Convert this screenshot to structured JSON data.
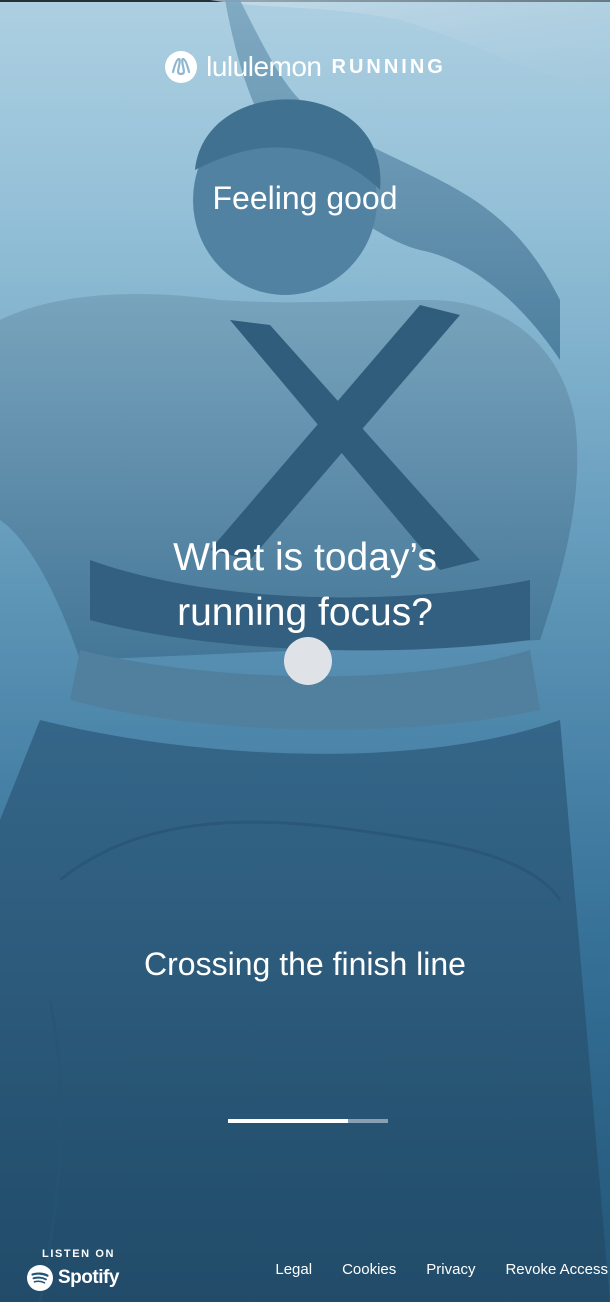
{
  "brand": {
    "name": "lululemon",
    "sub": "RUNNING",
    "logo_icon": "lululemon-logo-icon"
  },
  "options": {
    "top": "Feeling good",
    "bottom": "Crossing the finish line"
  },
  "question": {
    "line1": "What is today’s",
    "line2": "running focus?"
  },
  "progress": {
    "fraction": 0.75
  },
  "spotify": {
    "listen_on": "LISTEN ON",
    "name": "Spotify",
    "icon": "spotify-icon"
  },
  "footer": {
    "links": [
      "Legal",
      "Cookies",
      "Privacy",
      "Revoke Access"
    ]
  },
  "colors": {
    "text": "#ffffff",
    "dot": "#dfe3e8",
    "background_top": "#bfdbea",
    "background_bottom": "#174768"
  }
}
